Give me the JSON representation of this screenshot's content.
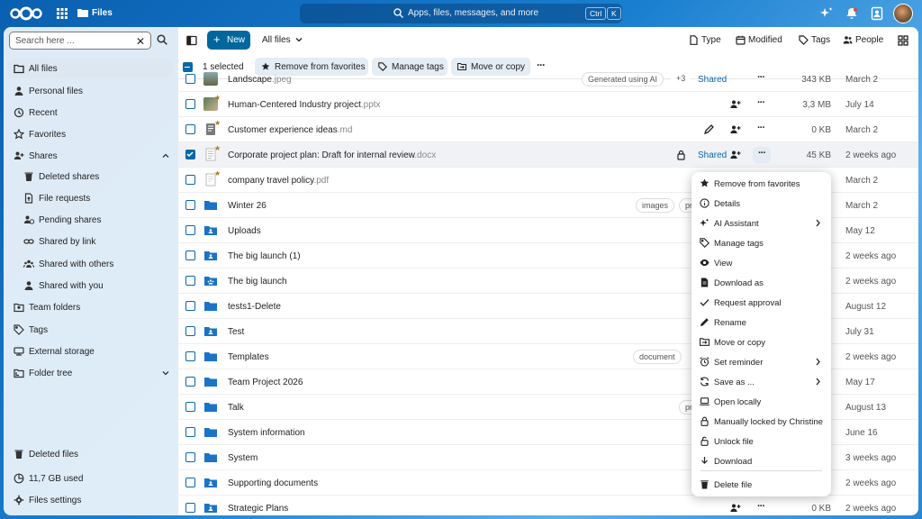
{
  "header": {
    "app_title": "Files",
    "search_placeholder": "Apps, files, messages, and more",
    "shortcut_ctrl": "Ctrl",
    "shortcut_k": "K"
  },
  "sidebar": {
    "search_value": "Search here ...",
    "items": [
      {
        "label": "All files",
        "icon": "folder-icon"
      },
      {
        "label": "Personal files",
        "icon": "person-icon"
      },
      {
        "label": "Recent",
        "icon": "history-icon"
      },
      {
        "label": "Favorites",
        "icon": "star-icon"
      },
      {
        "label": "Shares",
        "icon": "share-icon"
      },
      {
        "label": "Deleted shares",
        "icon": "trash-icon"
      },
      {
        "label": "File requests",
        "icon": "file-upload-icon"
      },
      {
        "label": "Pending shares",
        "icon": "pending-icon"
      },
      {
        "label": "Shared by link",
        "icon": "link-icon"
      },
      {
        "label": "Shared with others",
        "icon": "group-icon"
      },
      {
        "label": "Shared with you",
        "icon": "person-icon"
      },
      {
        "label": "Team folders",
        "icon": "team-folder-icon"
      },
      {
        "label": "Tags",
        "icon": "tag-icon"
      },
      {
        "label": "External storage",
        "icon": "storage-icon"
      },
      {
        "label": "Folder tree",
        "icon": "folder-tree-icon"
      }
    ],
    "bottom": [
      {
        "label": "Deleted files",
        "icon": "trash-icon"
      },
      {
        "label": "11,7 GB used",
        "icon": "pie-chart-icon"
      },
      {
        "label": "Files settings",
        "icon": "gear-icon"
      }
    ]
  },
  "toolbar": {
    "new_label": "New",
    "view_label": "All files",
    "filters": [
      "Type",
      "Modified",
      "Tags",
      "People"
    ]
  },
  "selection": {
    "count_text": "1 selected",
    "actions": [
      "Remove from favorites",
      "Manage tags",
      "Move or copy"
    ]
  },
  "files": [
    {
      "name": "Landscape",
      "ext": ".jpeg",
      "tag": "Generated using AI",
      "extra": "+3",
      "shared": "Shared",
      "size": "343 KB",
      "date": "March 2"
    },
    {
      "name": "Human-Centered Industry project",
      "ext": ".pptx",
      "size": "3,3 MB",
      "date": "July 14"
    },
    {
      "name": "Customer experience ideas",
      "ext": ".md",
      "size": "0 KB",
      "date": "March 2"
    },
    {
      "name": "Corporate project plan: Draft for internal review",
      "ext": ".docx",
      "shared": "Shared",
      "size": "45 KB",
      "date": "2 weeks ago"
    },
    {
      "name": "company travel policy",
      "ext": ".pdf",
      "date": "March 2"
    },
    {
      "name": "Winter 26",
      "tag": "images",
      "tag2": "pr",
      "date": "March 2"
    },
    {
      "name": "Uploads",
      "date": "May 12"
    },
    {
      "name": "The big launch (1)",
      "date": "2 weeks ago"
    },
    {
      "name": "The big launch",
      "date": "2 weeks ago"
    },
    {
      "name": "tests1-Delete",
      "date": "August 12"
    },
    {
      "name": "Test",
      "date": "July 31"
    },
    {
      "name": "Templates",
      "tag": "document",
      "date": "2 weeks ago"
    },
    {
      "name": "Team Project 2026",
      "date": "May 17"
    },
    {
      "name": "Talk",
      "tag2": "pr",
      "date": "August 13"
    },
    {
      "name": "System information",
      "date": "June 16"
    },
    {
      "name": "System",
      "date": "3 weeks ago"
    },
    {
      "name": "Supporting documents",
      "date": "2 weeks ago"
    },
    {
      "name": "Strategic Plans",
      "size": "0 KB",
      "date": "2 weeks ago"
    }
  ],
  "menu": [
    {
      "label": "Remove from favorites",
      "icon": "star-icon"
    },
    {
      "label": "Details",
      "icon": "info-icon"
    },
    {
      "label": "AI Assistant",
      "icon": "sparkle-icon",
      "submenu": true
    },
    {
      "label": "Manage tags",
      "icon": "tag-icon"
    },
    {
      "label": "View",
      "icon": "eye-icon"
    },
    {
      "label": "Download as",
      "icon": "file-icon"
    },
    {
      "label": "Request approval",
      "icon": "check-icon"
    },
    {
      "label": "Rename",
      "icon": "pencil-icon"
    },
    {
      "label": "Move or copy",
      "icon": "folder-move-icon"
    },
    {
      "label": "Set reminder",
      "icon": "alarm-icon",
      "submenu": true
    },
    {
      "label": "Save as ...",
      "icon": "sync-icon",
      "submenu": true
    },
    {
      "label": "Open locally",
      "icon": "laptop-icon"
    },
    {
      "label": "Manually locked by Christine",
      "icon": "lock-icon"
    },
    {
      "label": "Unlock file",
      "icon": "unlock-icon"
    },
    {
      "label": "Download",
      "icon": "download-icon"
    },
    {
      "label": "Delete file",
      "icon": "trash-icon"
    }
  ],
  "colors": {
    "accent": "#00679e",
    "background": "#1a7fd0",
    "favorite": "#a57a1f"
  }
}
